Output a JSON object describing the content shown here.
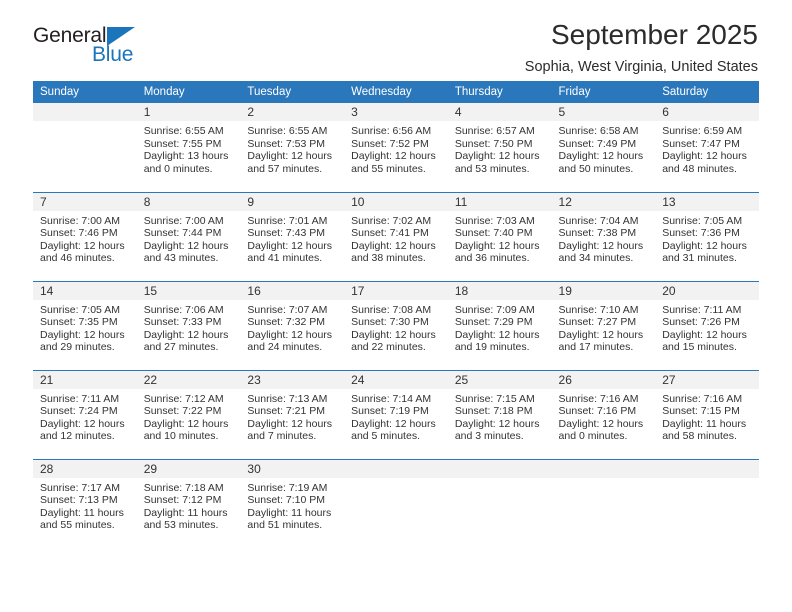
{
  "brand": {
    "name_part1": "General",
    "name_part2": "Blue",
    "accent_color": "#1b75bb"
  },
  "header": {
    "title": "September 2025",
    "subtitle": "Sophia, West Virginia, United States"
  },
  "calendar": {
    "header_bg": "#2b77bc",
    "daynum_bg": "#f2f2f2",
    "weekday_headers": [
      "Sunday",
      "Monday",
      "Tuesday",
      "Wednesday",
      "Thursday",
      "Friday",
      "Saturday"
    ],
    "weeks": [
      [
        {
          "day": "",
          "sunrise": "",
          "sunset": "",
          "daylight_line1": "",
          "daylight_line2": ""
        },
        {
          "day": "1",
          "sunrise": "Sunrise: 6:55 AM",
          "sunset": "Sunset: 7:55 PM",
          "daylight_line1": "Daylight: 13 hours",
          "daylight_line2": "and 0 minutes."
        },
        {
          "day": "2",
          "sunrise": "Sunrise: 6:55 AM",
          "sunset": "Sunset: 7:53 PM",
          "daylight_line1": "Daylight: 12 hours",
          "daylight_line2": "and 57 minutes."
        },
        {
          "day": "3",
          "sunrise": "Sunrise: 6:56 AM",
          "sunset": "Sunset: 7:52 PM",
          "daylight_line1": "Daylight: 12 hours",
          "daylight_line2": "and 55 minutes."
        },
        {
          "day": "4",
          "sunrise": "Sunrise: 6:57 AM",
          "sunset": "Sunset: 7:50 PM",
          "daylight_line1": "Daylight: 12 hours",
          "daylight_line2": "and 53 minutes."
        },
        {
          "day": "5",
          "sunrise": "Sunrise: 6:58 AM",
          "sunset": "Sunset: 7:49 PM",
          "daylight_line1": "Daylight: 12 hours",
          "daylight_line2": "and 50 minutes."
        },
        {
          "day": "6",
          "sunrise": "Sunrise: 6:59 AM",
          "sunset": "Sunset: 7:47 PM",
          "daylight_line1": "Daylight: 12 hours",
          "daylight_line2": "and 48 minutes."
        }
      ],
      [
        {
          "day": "7",
          "sunrise": "Sunrise: 7:00 AM",
          "sunset": "Sunset: 7:46 PM",
          "daylight_line1": "Daylight: 12 hours",
          "daylight_line2": "and 46 minutes."
        },
        {
          "day": "8",
          "sunrise": "Sunrise: 7:00 AM",
          "sunset": "Sunset: 7:44 PM",
          "daylight_line1": "Daylight: 12 hours",
          "daylight_line2": "and 43 minutes."
        },
        {
          "day": "9",
          "sunrise": "Sunrise: 7:01 AM",
          "sunset": "Sunset: 7:43 PM",
          "daylight_line1": "Daylight: 12 hours",
          "daylight_line2": "and 41 minutes."
        },
        {
          "day": "10",
          "sunrise": "Sunrise: 7:02 AM",
          "sunset": "Sunset: 7:41 PM",
          "daylight_line1": "Daylight: 12 hours",
          "daylight_line2": "and 38 minutes."
        },
        {
          "day": "11",
          "sunrise": "Sunrise: 7:03 AM",
          "sunset": "Sunset: 7:40 PM",
          "daylight_line1": "Daylight: 12 hours",
          "daylight_line2": "and 36 minutes."
        },
        {
          "day": "12",
          "sunrise": "Sunrise: 7:04 AM",
          "sunset": "Sunset: 7:38 PM",
          "daylight_line1": "Daylight: 12 hours",
          "daylight_line2": "and 34 minutes."
        },
        {
          "day": "13",
          "sunrise": "Sunrise: 7:05 AM",
          "sunset": "Sunset: 7:36 PM",
          "daylight_line1": "Daylight: 12 hours",
          "daylight_line2": "and 31 minutes."
        }
      ],
      [
        {
          "day": "14",
          "sunrise": "Sunrise: 7:05 AM",
          "sunset": "Sunset: 7:35 PM",
          "daylight_line1": "Daylight: 12 hours",
          "daylight_line2": "and 29 minutes."
        },
        {
          "day": "15",
          "sunrise": "Sunrise: 7:06 AM",
          "sunset": "Sunset: 7:33 PM",
          "daylight_line1": "Daylight: 12 hours",
          "daylight_line2": "and 27 minutes."
        },
        {
          "day": "16",
          "sunrise": "Sunrise: 7:07 AM",
          "sunset": "Sunset: 7:32 PM",
          "daylight_line1": "Daylight: 12 hours",
          "daylight_line2": "and 24 minutes."
        },
        {
          "day": "17",
          "sunrise": "Sunrise: 7:08 AM",
          "sunset": "Sunset: 7:30 PM",
          "daylight_line1": "Daylight: 12 hours",
          "daylight_line2": "and 22 minutes."
        },
        {
          "day": "18",
          "sunrise": "Sunrise: 7:09 AM",
          "sunset": "Sunset: 7:29 PM",
          "daylight_line1": "Daylight: 12 hours",
          "daylight_line2": "and 19 minutes."
        },
        {
          "day": "19",
          "sunrise": "Sunrise: 7:10 AM",
          "sunset": "Sunset: 7:27 PM",
          "daylight_line1": "Daylight: 12 hours",
          "daylight_line2": "and 17 minutes."
        },
        {
          "day": "20",
          "sunrise": "Sunrise: 7:11 AM",
          "sunset": "Sunset: 7:26 PM",
          "daylight_line1": "Daylight: 12 hours",
          "daylight_line2": "and 15 minutes."
        }
      ],
      [
        {
          "day": "21",
          "sunrise": "Sunrise: 7:11 AM",
          "sunset": "Sunset: 7:24 PM",
          "daylight_line1": "Daylight: 12 hours",
          "daylight_line2": "and 12 minutes."
        },
        {
          "day": "22",
          "sunrise": "Sunrise: 7:12 AM",
          "sunset": "Sunset: 7:22 PM",
          "daylight_line1": "Daylight: 12 hours",
          "daylight_line2": "and 10 minutes."
        },
        {
          "day": "23",
          "sunrise": "Sunrise: 7:13 AM",
          "sunset": "Sunset: 7:21 PM",
          "daylight_line1": "Daylight: 12 hours",
          "daylight_line2": "and 7 minutes."
        },
        {
          "day": "24",
          "sunrise": "Sunrise: 7:14 AM",
          "sunset": "Sunset: 7:19 PM",
          "daylight_line1": "Daylight: 12 hours",
          "daylight_line2": "and 5 minutes."
        },
        {
          "day": "25",
          "sunrise": "Sunrise: 7:15 AM",
          "sunset": "Sunset: 7:18 PM",
          "daylight_line1": "Daylight: 12 hours",
          "daylight_line2": "and 3 minutes."
        },
        {
          "day": "26",
          "sunrise": "Sunrise: 7:16 AM",
          "sunset": "Sunset: 7:16 PM",
          "daylight_line1": "Daylight: 12 hours",
          "daylight_line2": "and 0 minutes."
        },
        {
          "day": "27",
          "sunrise": "Sunrise: 7:16 AM",
          "sunset": "Sunset: 7:15 PM",
          "daylight_line1": "Daylight: 11 hours",
          "daylight_line2": "and 58 minutes."
        }
      ],
      [
        {
          "day": "28",
          "sunrise": "Sunrise: 7:17 AM",
          "sunset": "Sunset: 7:13 PM",
          "daylight_line1": "Daylight: 11 hours",
          "daylight_line2": "and 55 minutes."
        },
        {
          "day": "29",
          "sunrise": "Sunrise: 7:18 AM",
          "sunset": "Sunset: 7:12 PM",
          "daylight_line1": "Daylight: 11 hours",
          "daylight_line2": "and 53 minutes."
        },
        {
          "day": "30",
          "sunrise": "Sunrise: 7:19 AM",
          "sunset": "Sunset: 7:10 PM",
          "daylight_line1": "Daylight: 11 hours",
          "daylight_line2": "and 51 minutes."
        },
        {
          "day": "",
          "sunrise": "",
          "sunset": "",
          "daylight_line1": "",
          "daylight_line2": ""
        },
        {
          "day": "",
          "sunrise": "",
          "sunset": "",
          "daylight_line1": "",
          "daylight_line2": ""
        },
        {
          "day": "",
          "sunrise": "",
          "sunset": "",
          "daylight_line1": "",
          "daylight_line2": ""
        },
        {
          "day": "",
          "sunrise": "",
          "sunset": "",
          "daylight_line1": "",
          "daylight_line2": ""
        }
      ]
    ]
  }
}
